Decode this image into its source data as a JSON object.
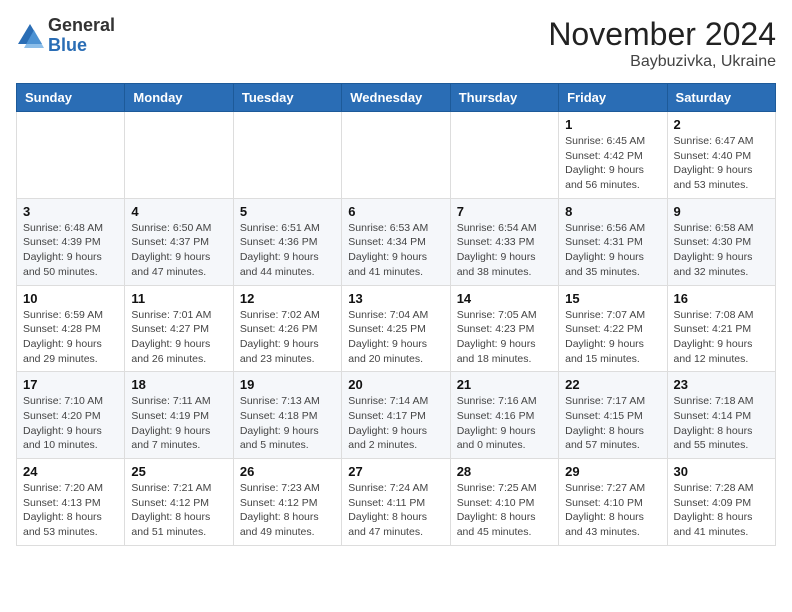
{
  "logo": {
    "general": "General",
    "blue": "Blue"
  },
  "header": {
    "month_title": "November 2024",
    "location": "Baybuzivka, Ukraine"
  },
  "days_of_week": [
    "Sunday",
    "Monday",
    "Tuesday",
    "Wednesday",
    "Thursday",
    "Friday",
    "Saturday"
  ],
  "weeks": [
    [
      {
        "day": "",
        "info": ""
      },
      {
        "day": "",
        "info": ""
      },
      {
        "day": "",
        "info": ""
      },
      {
        "day": "",
        "info": ""
      },
      {
        "day": "",
        "info": ""
      },
      {
        "day": "1",
        "info": "Sunrise: 6:45 AM\nSunset: 4:42 PM\nDaylight: 9 hours and 56 minutes."
      },
      {
        "day": "2",
        "info": "Sunrise: 6:47 AM\nSunset: 4:40 PM\nDaylight: 9 hours and 53 minutes."
      }
    ],
    [
      {
        "day": "3",
        "info": "Sunrise: 6:48 AM\nSunset: 4:39 PM\nDaylight: 9 hours and 50 minutes."
      },
      {
        "day": "4",
        "info": "Sunrise: 6:50 AM\nSunset: 4:37 PM\nDaylight: 9 hours and 47 minutes."
      },
      {
        "day": "5",
        "info": "Sunrise: 6:51 AM\nSunset: 4:36 PM\nDaylight: 9 hours and 44 minutes."
      },
      {
        "day": "6",
        "info": "Sunrise: 6:53 AM\nSunset: 4:34 PM\nDaylight: 9 hours and 41 minutes."
      },
      {
        "day": "7",
        "info": "Sunrise: 6:54 AM\nSunset: 4:33 PM\nDaylight: 9 hours and 38 minutes."
      },
      {
        "day": "8",
        "info": "Sunrise: 6:56 AM\nSunset: 4:31 PM\nDaylight: 9 hours and 35 minutes."
      },
      {
        "day": "9",
        "info": "Sunrise: 6:58 AM\nSunset: 4:30 PM\nDaylight: 9 hours and 32 minutes."
      }
    ],
    [
      {
        "day": "10",
        "info": "Sunrise: 6:59 AM\nSunset: 4:28 PM\nDaylight: 9 hours and 29 minutes."
      },
      {
        "day": "11",
        "info": "Sunrise: 7:01 AM\nSunset: 4:27 PM\nDaylight: 9 hours and 26 minutes."
      },
      {
        "day": "12",
        "info": "Sunrise: 7:02 AM\nSunset: 4:26 PM\nDaylight: 9 hours and 23 minutes."
      },
      {
        "day": "13",
        "info": "Sunrise: 7:04 AM\nSunset: 4:25 PM\nDaylight: 9 hours and 20 minutes."
      },
      {
        "day": "14",
        "info": "Sunrise: 7:05 AM\nSunset: 4:23 PM\nDaylight: 9 hours and 18 minutes."
      },
      {
        "day": "15",
        "info": "Sunrise: 7:07 AM\nSunset: 4:22 PM\nDaylight: 9 hours and 15 minutes."
      },
      {
        "day": "16",
        "info": "Sunrise: 7:08 AM\nSunset: 4:21 PM\nDaylight: 9 hours and 12 minutes."
      }
    ],
    [
      {
        "day": "17",
        "info": "Sunrise: 7:10 AM\nSunset: 4:20 PM\nDaylight: 9 hours and 10 minutes."
      },
      {
        "day": "18",
        "info": "Sunrise: 7:11 AM\nSunset: 4:19 PM\nDaylight: 9 hours and 7 minutes."
      },
      {
        "day": "19",
        "info": "Sunrise: 7:13 AM\nSunset: 4:18 PM\nDaylight: 9 hours and 5 minutes."
      },
      {
        "day": "20",
        "info": "Sunrise: 7:14 AM\nSunset: 4:17 PM\nDaylight: 9 hours and 2 minutes."
      },
      {
        "day": "21",
        "info": "Sunrise: 7:16 AM\nSunset: 4:16 PM\nDaylight: 9 hours and 0 minutes."
      },
      {
        "day": "22",
        "info": "Sunrise: 7:17 AM\nSunset: 4:15 PM\nDaylight: 8 hours and 57 minutes."
      },
      {
        "day": "23",
        "info": "Sunrise: 7:18 AM\nSunset: 4:14 PM\nDaylight: 8 hours and 55 minutes."
      }
    ],
    [
      {
        "day": "24",
        "info": "Sunrise: 7:20 AM\nSunset: 4:13 PM\nDaylight: 8 hours and 53 minutes."
      },
      {
        "day": "25",
        "info": "Sunrise: 7:21 AM\nSunset: 4:12 PM\nDaylight: 8 hours and 51 minutes."
      },
      {
        "day": "26",
        "info": "Sunrise: 7:23 AM\nSunset: 4:12 PM\nDaylight: 8 hours and 49 minutes."
      },
      {
        "day": "27",
        "info": "Sunrise: 7:24 AM\nSunset: 4:11 PM\nDaylight: 8 hours and 47 minutes."
      },
      {
        "day": "28",
        "info": "Sunrise: 7:25 AM\nSunset: 4:10 PM\nDaylight: 8 hours and 45 minutes."
      },
      {
        "day": "29",
        "info": "Sunrise: 7:27 AM\nSunset: 4:10 PM\nDaylight: 8 hours and 43 minutes."
      },
      {
        "day": "30",
        "info": "Sunrise: 7:28 AM\nSunset: 4:09 PM\nDaylight: 8 hours and 41 minutes."
      }
    ]
  ]
}
